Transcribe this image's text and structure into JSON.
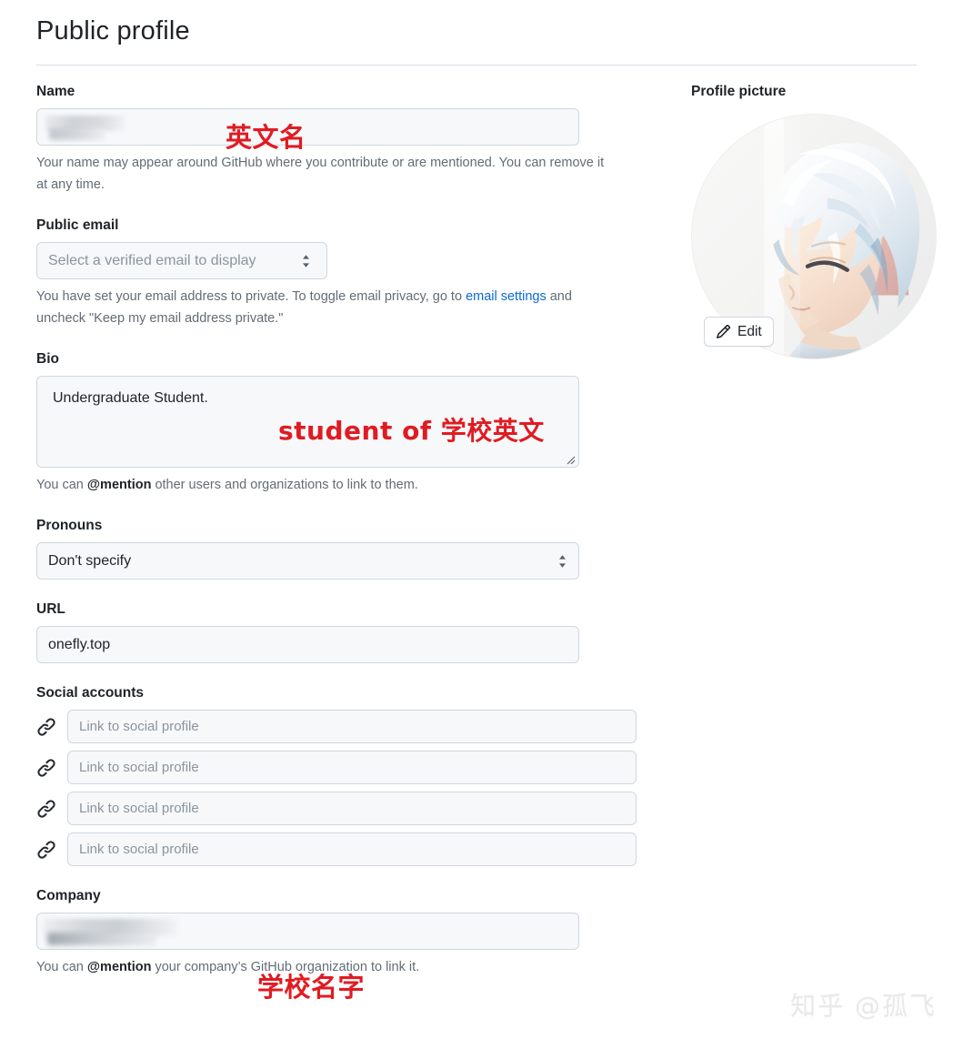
{
  "header": {
    "title": "Public profile"
  },
  "form": {
    "name": {
      "label": "Name",
      "value": "",
      "redacted": true,
      "annotation": "英文名",
      "help": "Your name may appear around GitHub where you contribute or are mentioned. You can remove it at any time."
    },
    "public_email": {
      "label": "Public email",
      "selected": "Select a verified email to display",
      "help_before": "You have set your email address to private. To toggle email privacy, go to ",
      "help_link": "email settings",
      "help_after": " and uncheck \"Keep my email address private.\""
    },
    "bio": {
      "label": "Bio",
      "value": "Undergraduate Student.",
      "annotation": "student of 学校英文",
      "help_before": "You can ",
      "help_mention": "@mention",
      "help_after": " other users and organizations to link to them."
    },
    "pronouns": {
      "label": "Pronouns",
      "selected": "Don't specify"
    },
    "url": {
      "label": "URL",
      "value": "onefly.top"
    },
    "social_accounts": {
      "label": "Social accounts",
      "placeholder": "Link to social profile",
      "rows": [
        {
          "icon": "link-icon",
          "value": ""
        },
        {
          "icon": "link-icon",
          "value": ""
        },
        {
          "icon": "link-icon",
          "value": ""
        },
        {
          "icon": "link-icon",
          "value": ""
        }
      ]
    },
    "company": {
      "label": "Company",
      "value": "",
      "redacted": true,
      "annotation": "学校名字",
      "help_before": "You can ",
      "help_mention": "@mention",
      "help_after": " your company’s GitHub organization to link it."
    }
  },
  "profile_picture": {
    "label": "Profile picture",
    "edit_label": "Edit",
    "edit_icon": "pencil-icon",
    "alt": "anime character avatar with white hair"
  },
  "watermark": {
    "text": "知乎 @孤飞"
  },
  "colors": {
    "annotation_red": "#e11b22",
    "link_blue": "#0969da",
    "input_bg": "#f6f8fa",
    "border": "#d0d7de",
    "text": "#1f2328",
    "muted_text": "#636c76",
    "placeholder": "#8b949e"
  }
}
